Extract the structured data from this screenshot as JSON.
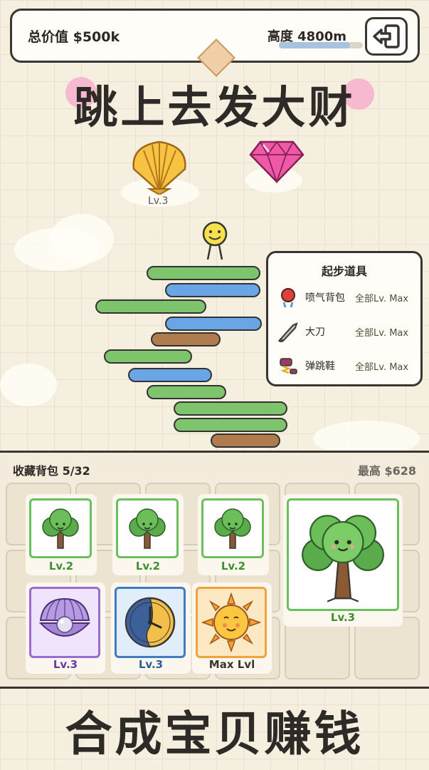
{
  "top_bar": {
    "total_value": "总价值 $500k",
    "height": "高度 4800m",
    "height_progress": 0.85,
    "exit_icon": "exit-door-icon"
  },
  "title": "跳上去发大财",
  "floating_items": {
    "shell_level": "Lv.3",
    "gem_icon": "pink-diamond-icon",
    "shell_icon": "golden-shell-icon",
    "character_icon": "smiley-jumper-icon"
  },
  "start_items": {
    "title": "起步道具",
    "items": [
      {
        "name": "喷气背包",
        "level": "全部Lv. Max",
        "icon": "jetpack-icon"
      },
      {
        "name": "大刀",
        "level": "全部Lv. Max",
        "icon": "blade-icon"
      },
      {
        "name": "弹跳鞋",
        "level": "全部Lv. Max",
        "icon": "spring-shoes-icon"
      }
    ]
  },
  "inventory": {
    "title": "收藏背包 5/32",
    "best": "最高 $628",
    "cards": [
      {
        "level": "Lv.2",
        "icon": "tree-icon",
        "frame": "#6bbf5d"
      },
      {
        "level": "Lv.2",
        "icon": "tree-icon",
        "frame": "#6bbf5d"
      },
      {
        "level": "Lv.2",
        "icon": "tree-icon",
        "frame": "#6bbf5d"
      },
      {
        "level": "Lv.3",
        "icon": "pearl-shell-icon",
        "frame": "#9b6ccf"
      },
      {
        "level": "Lv.3",
        "icon": "clock-icon",
        "frame": "#3f7cc2"
      },
      {
        "level": "Max Lvl",
        "icon": "sun-icon",
        "frame": "#f0a33a"
      }
    ],
    "result": {
      "level": "Lv.3",
      "icon": "big-tree-icon",
      "frame": "#6bbf5d"
    }
  },
  "bottom_title": "合成宝贝赚钱",
  "colors": {
    "green": "#7ec46d",
    "blue": "#6aa6e6",
    "brown": "#b07b4f",
    "outline": "#3a3530"
  }
}
